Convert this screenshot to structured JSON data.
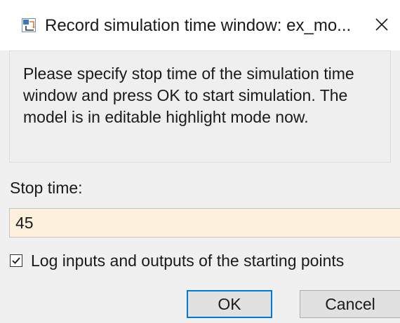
{
  "window": {
    "title": "Record simulation time window: ex_mo...",
    "close_glyph": "✕",
    "icon": "simulink-model-icon"
  },
  "message": {
    "text": "Please specify stop time of the simulation time window and press OK to start simulation. The model is in editable highlight mode now."
  },
  "stop_time": {
    "label": "Stop time:",
    "value": "45",
    "background_color": "#fdf1dd"
  },
  "log_checkbox": {
    "label": "Log inputs and outputs of the starting points",
    "checked": true
  },
  "buttons": {
    "ok_label": "OK",
    "cancel_label": "Cancel",
    "focus_color": "#0078d7"
  }
}
